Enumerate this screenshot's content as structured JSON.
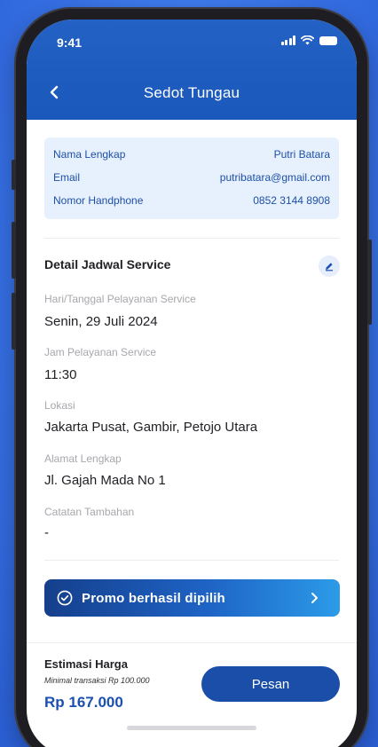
{
  "status_bar": {
    "time": "9:41"
  },
  "header": {
    "title": "Sedot Tungau"
  },
  "user_info": {
    "rows": [
      {
        "label": "Nama Lengkap",
        "value": "Putri Batara"
      },
      {
        "label": "Email",
        "value": "putribatara@gmail.com"
      },
      {
        "label": "Nomor Handphone",
        "value": "0852 3144 8908"
      }
    ]
  },
  "schedule": {
    "title": "Detail Jadwal Service",
    "fields": [
      {
        "label": "Hari/Tanggal Pelayanan Service",
        "value": "Senin, 29 Juli 2024"
      },
      {
        "label": "Jam Pelayanan Service",
        "value": "11:30"
      },
      {
        "label": "Lokasi",
        "value": "Jakarta Pusat, Gambir, Petojo Utara"
      },
      {
        "label": "Alamat Lengkap",
        "value": "Jl. Gajah Mada No 1"
      },
      {
        "label": "Catatan Tambahan",
        "value": "-"
      }
    ]
  },
  "promo": {
    "label": "Promo berhasil dipilih",
    "icon": "check-circle-icon"
  },
  "footer": {
    "title": "Estimasi Harga",
    "note": "Minimal transaksi Rp 100.000",
    "price": "Rp 167.000",
    "button_label": "Pesan"
  },
  "colors": {
    "primary": "#1b58bb",
    "accent_light": "#e7f0fd",
    "price": "#1b4fb0"
  }
}
